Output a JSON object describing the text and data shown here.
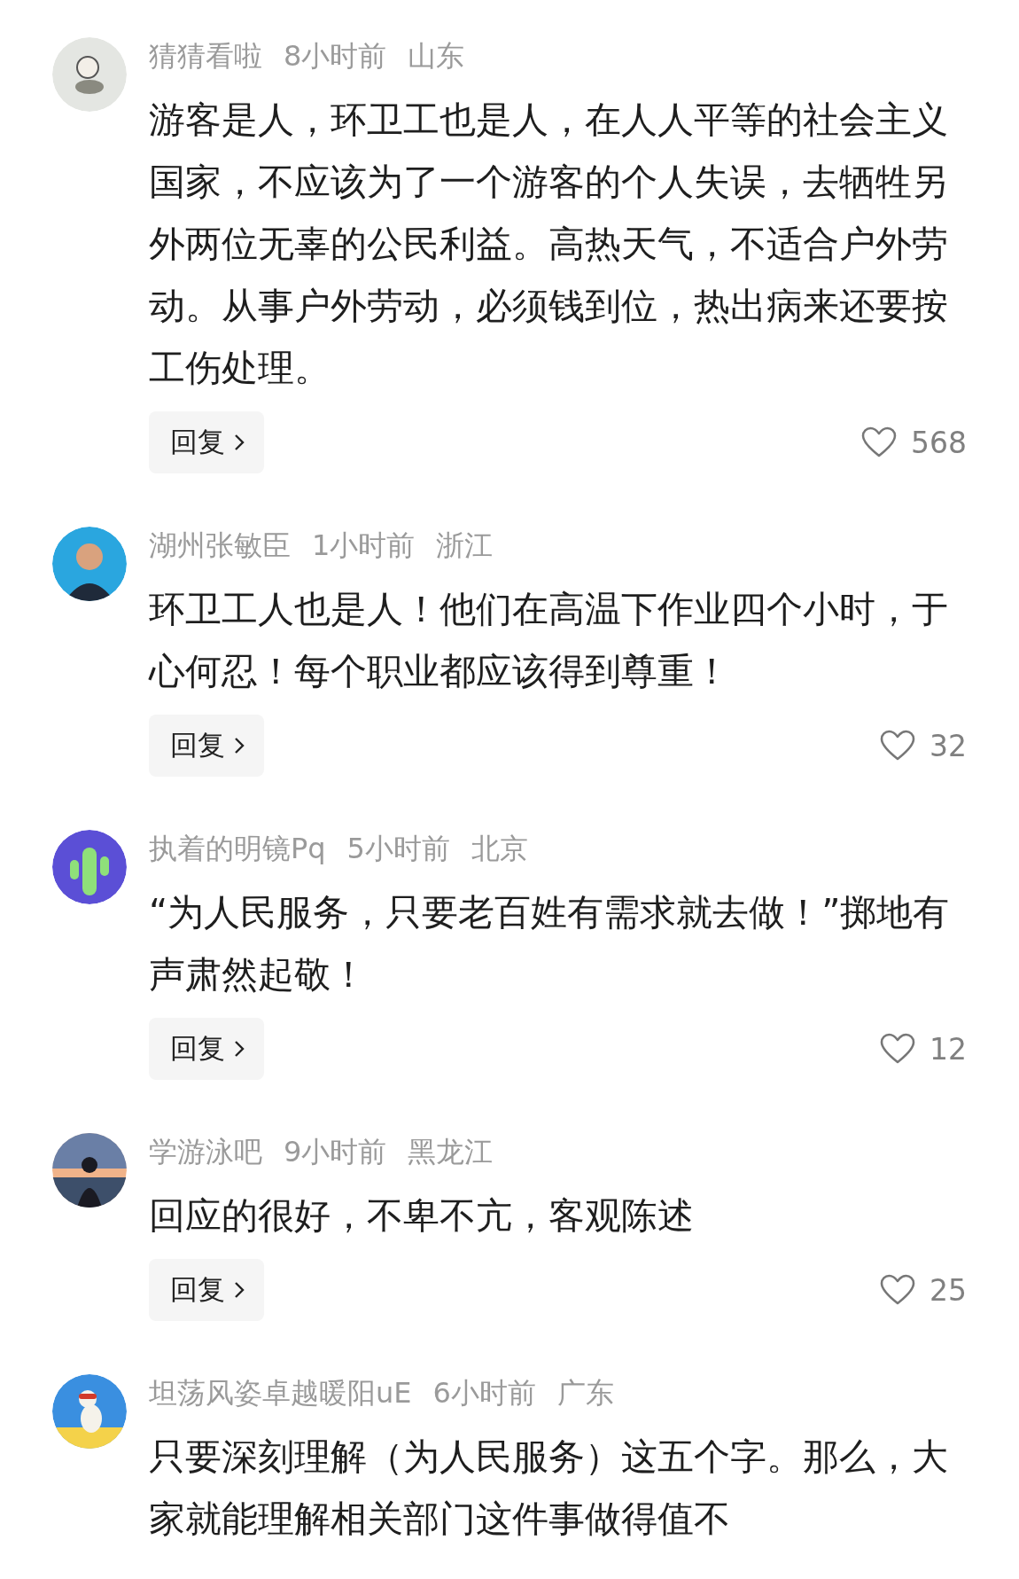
{
  "comments": [
    {
      "user": "猜猜看啦",
      "time": "8小时前",
      "region": "山东",
      "text": "游客是人，环卫工也是人，在人人平等的社会主义国家，不应该为了一个游客的个人失误，去牺牲另外两位无辜的公民利益。高热天气，不适合户外劳动。从事户外劳动，必须钱到位，热出病来还要按工伤处理。",
      "reply": "回复",
      "likes": "568"
    },
    {
      "user": "湖州张敏臣",
      "time": "1小时前",
      "region": "浙江",
      "text": "环卫工人也是人！他们在高温下作业四个小时，于心何忍！每个职业都应该得到尊重！",
      "reply": "回复",
      "likes": "32"
    },
    {
      "user": "执着的明镜Pq",
      "time": "5小时前",
      "region": "北京",
      "text": "“为人民服务，只要老百姓有需求就去做！”掷地有声肃然起敬！",
      "reply": "回复",
      "likes": "12"
    },
    {
      "user": "学游泳吧",
      "time": "9小时前",
      "region": "黑龙江",
      "text": "回应的很好，不卑不亢，客观陈述",
      "reply": "回复",
      "likes": "25"
    },
    {
      "user": "坦荡风姿卓越暖阳uE",
      "time": "6小时前",
      "region": "广东",
      "text": "只要深刻理解（为人民服务）这五个字。那么，大家就能理解相关部门这件事做得值不"
    }
  ]
}
